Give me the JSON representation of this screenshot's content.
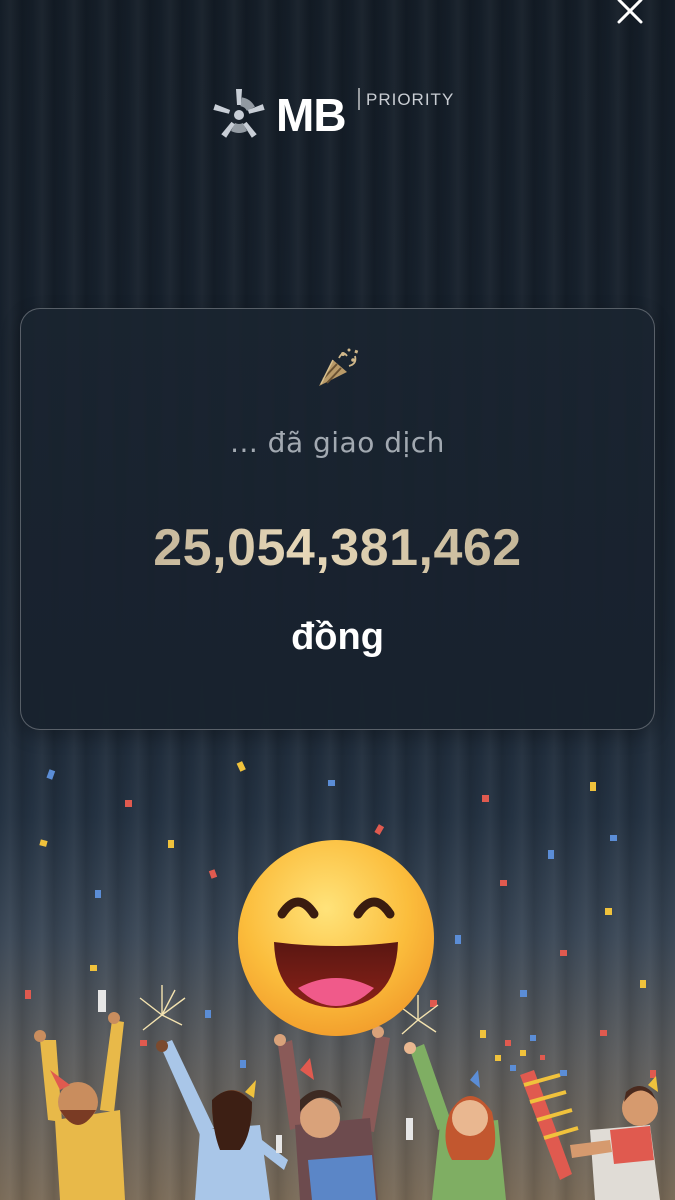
{
  "header": {
    "brand": "MB",
    "brand_tier": "PRIORITY",
    "close_icon": "close-icon",
    "logo_icon": "mb-star-logo"
  },
  "card": {
    "icon": "party-popper-icon",
    "subtitle": "... đã giao dịch",
    "amount": "25,054,381,462",
    "unit": "đồng"
  },
  "overlay": {
    "emoji": "grinning-face-emoji"
  },
  "colors": {
    "background_top": "#141d27",
    "background_bottom": "#7a6b58",
    "amount_gold": "#e6d7b8",
    "card_border": "#4a5560",
    "text_white": "#ffffff",
    "subtitle_gray": "#a2a9b1"
  }
}
